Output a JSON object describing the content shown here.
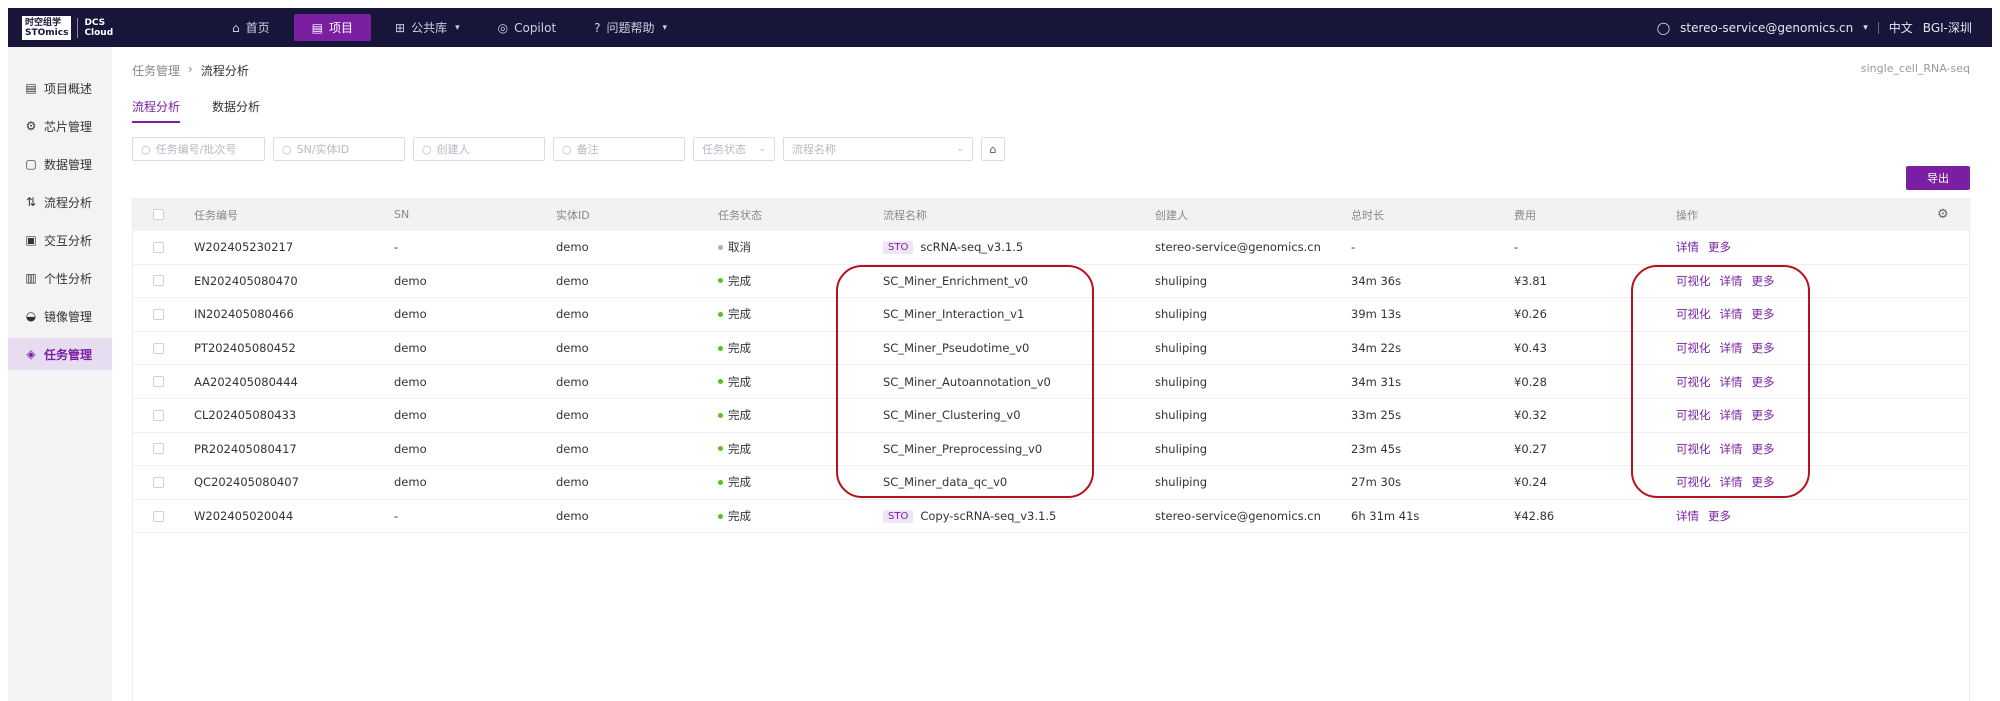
{
  "topbar": {
    "logo": {
      "line1": "时空组学",
      "line2": "STOmics",
      "product_line1": "DCS",
      "product_line2": "Cloud"
    },
    "nav": [
      {
        "label": "首页",
        "icon": "home-icon",
        "active": false,
        "dropdown": false
      },
      {
        "label": "项目",
        "icon": "file-icon",
        "active": true,
        "dropdown": false
      },
      {
        "label": "公共库",
        "icon": "grid-icon",
        "active": false,
        "dropdown": true
      },
      {
        "label": "Copilot",
        "icon": "globe-icon",
        "active": false,
        "dropdown": false
      },
      {
        "label": "问题帮助",
        "icon": "help-icon",
        "active": false,
        "dropdown": true
      }
    ],
    "user": "stereo-service@genomics.cn",
    "language": "中文",
    "org": "BGI-深圳"
  },
  "sidebar": {
    "items": [
      {
        "label": "项目概述",
        "icon": "document-icon",
        "active": false
      },
      {
        "label": "芯片管理",
        "icon": "chip-icon",
        "active": false
      },
      {
        "label": "数据管理",
        "icon": "data-file-icon",
        "active": false
      },
      {
        "label": "流程分析",
        "icon": "workflow-icon",
        "active": false
      },
      {
        "label": "交互分析",
        "icon": "interactive-icon",
        "active": false
      },
      {
        "label": "个性分析",
        "icon": "custom-analysis-icon",
        "active": false
      },
      {
        "label": "镜像管理",
        "icon": "image-icon",
        "active": false
      },
      {
        "label": "任务管理",
        "icon": "layers-icon",
        "active": true
      }
    ]
  },
  "breadcrumb": [
    "任务管理",
    "流程分析"
  ],
  "project_name": "single_cell_RNA-seq",
  "tabs": [
    {
      "label": "流程分析",
      "active": true
    },
    {
      "label": "数据分析",
      "active": false
    }
  ],
  "filters": {
    "task_id_placeholder": "任务编号/批次号",
    "sn_placeholder": "SN/实体ID",
    "creator_placeholder": "创建人",
    "note_placeholder": "备注",
    "status_placeholder": "任务状态",
    "flow_placeholder": "流程名称"
  },
  "export_label": "导出",
  "table": {
    "columns": [
      "任务编号",
      "SN",
      "实体ID",
      "任务状态",
      "流程名称",
      "创建人",
      "总时长",
      "费用",
      "操作"
    ],
    "rows": [
      {
        "id": "W202405230217",
        "sn": "-",
        "entity": "demo",
        "status": "取消",
        "status_type": "cancel",
        "tag": "STO",
        "flow": "scRNA-seq_v3.1.5",
        "creator": "stereo-service@genomics.cn",
        "duration": "-",
        "fee": "-",
        "ops": [
          "详情",
          "更多"
        ]
      },
      {
        "id": "EN202405080470",
        "sn": "demo",
        "entity": "demo",
        "status": "完成",
        "status_type": "ok",
        "tag": "",
        "flow": "SC_Miner_Enrichment_v0",
        "creator": "shuliping",
        "duration": "34m 36s",
        "fee": "¥3.81",
        "ops": [
          "可视化",
          "详情",
          "更多"
        ]
      },
      {
        "id": "IN202405080466",
        "sn": "demo",
        "entity": "demo",
        "status": "完成",
        "status_type": "ok",
        "tag": "",
        "flow": "SC_Miner_Interaction_v1",
        "creator": "shuliping",
        "duration": "39m 13s",
        "fee": "¥0.26",
        "ops": [
          "可视化",
          "详情",
          "更多"
        ]
      },
      {
        "id": "PT202405080452",
        "sn": "demo",
        "entity": "demo",
        "status": "完成",
        "status_type": "ok",
        "tag": "",
        "flow": "SC_Miner_Pseudotime_v0",
        "creator": "shuliping",
        "duration": "34m 22s",
        "fee": "¥0.43",
        "ops": [
          "可视化",
          "详情",
          "更多"
        ]
      },
      {
        "id": "AA202405080444",
        "sn": "demo",
        "entity": "demo",
        "status": "完成",
        "status_type": "ok",
        "tag": "",
        "flow": "SC_Miner_Autoannotation_v0",
        "creator": "shuliping",
        "duration": "34m 31s",
        "fee": "¥0.28",
        "ops": [
          "可视化",
          "详情",
          "更多"
        ]
      },
      {
        "id": "CL202405080433",
        "sn": "demo",
        "entity": "demo",
        "status": "完成",
        "status_type": "ok",
        "tag": "",
        "flow": "SC_Miner_Clustering_v0",
        "creator": "shuliping",
        "duration": "33m 25s",
        "fee": "¥0.32",
        "ops": [
          "可视化",
          "详情",
          "更多"
        ]
      },
      {
        "id": "PR202405080417",
        "sn": "demo",
        "entity": "demo",
        "status": "完成",
        "status_type": "ok",
        "tag": "",
        "flow": "SC_Miner_Preprocessing_v0",
        "creator": "shuliping",
        "duration": "23m 45s",
        "fee": "¥0.27",
        "ops": [
          "可视化",
          "详情",
          "更多"
        ]
      },
      {
        "id": "QC202405080407",
        "sn": "demo",
        "entity": "demo",
        "status": "完成",
        "status_type": "ok",
        "tag": "",
        "flow": "SC_Miner_data_qc_v0",
        "creator": "shuliping",
        "duration": "27m 30s",
        "fee": "¥0.24",
        "ops": [
          "可视化",
          "详情",
          "更多"
        ]
      },
      {
        "id": "W202405020044",
        "sn": "-",
        "entity": "demo",
        "status": "完成",
        "status_type": "ok",
        "tag": "STO",
        "flow": "Copy-scRNA-seq_v3.1.5",
        "creator": "stereo-service@genomics.cn",
        "duration": "6h 31m 41s",
        "fee": "¥42.86",
        "ops": [
          "详情",
          "更多"
        ]
      }
    ]
  },
  "colors": {
    "brand": "#7a1fa2",
    "topbar": "#17153a",
    "highlight": "#b5121b",
    "success": "#52c41a"
  }
}
